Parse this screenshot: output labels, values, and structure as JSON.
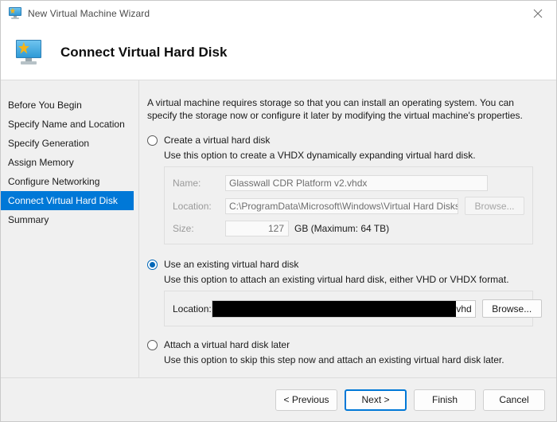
{
  "window": {
    "title": "New Virtual Machine Wizard",
    "icon": "vm-monitor-icon",
    "close_label": "close-icon"
  },
  "header": {
    "title": "Connect Virtual Hard Disk",
    "icon": "vm-monitor-icon"
  },
  "sidebar": {
    "items": [
      {
        "label": "Before You Begin",
        "active": false
      },
      {
        "label": "Specify Name and Location",
        "active": false
      },
      {
        "label": "Specify Generation",
        "active": false
      },
      {
        "label": "Assign Memory",
        "active": false
      },
      {
        "label": "Configure Networking",
        "active": false
      },
      {
        "label": "Connect Virtual Hard Disk",
        "active": true
      },
      {
        "label": "Summary",
        "active": false
      }
    ],
    "active_color": "#0078d7"
  },
  "main": {
    "intro": "A virtual machine requires storage so that you can install an operating system. You can specify the storage now or configure it later by modifying the virtual machine's properties.",
    "options": [
      {
        "id": "create",
        "label": "Create a virtual hard disk",
        "description": "Use this option to create a VHDX dynamically expanding virtual hard disk.",
        "selected": false,
        "enabled": false,
        "fields": {
          "name_label": "Name:",
          "name_value": "Glasswall CDR Platform v2.vhdx",
          "location_label": "Location:",
          "location_value": "C:\\ProgramData\\Microsoft\\Windows\\Virtual Hard Disks\\",
          "browse_label": "Browse...",
          "size_label": "Size:",
          "size_value": "127",
          "size_suffix": "GB (Maximum: 64 TB)"
        }
      },
      {
        "id": "existing",
        "label": "Use an existing virtual hard disk",
        "description": "Use this option to attach an existing virtual hard disk, either VHD or VHDX format.",
        "selected": true,
        "enabled": true,
        "fields": {
          "location_label": "Location:",
          "location_value": "vhd",
          "location_redacted": true,
          "browse_label": "Browse..."
        }
      },
      {
        "id": "later",
        "label": "Attach a virtual hard disk later",
        "description": "Use this option to skip this step now and attach an existing virtual hard disk later.",
        "selected": false,
        "enabled": true
      }
    ]
  },
  "footer": {
    "previous_label": "< Previous",
    "next_label": "Next >",
    "finish_label": "Finish",
    "cancel_label": "Cancel",
    "focus_accent": "#0078d7"
  }
}
